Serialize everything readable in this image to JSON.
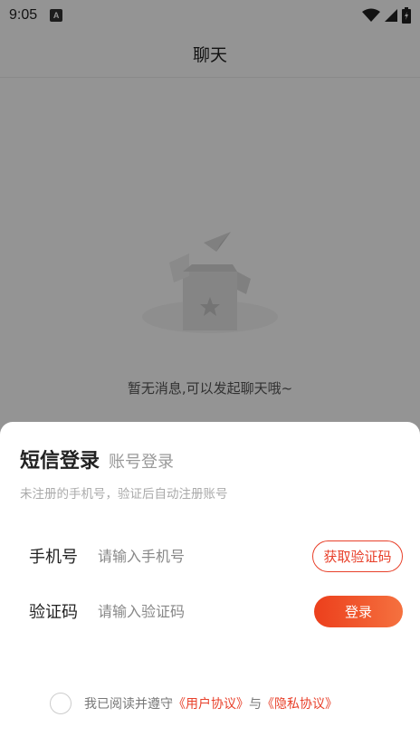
{
  "status_bar": {
    "time": "9:05",
    "app_icon_letter": "A"
  },
  "page": {
    "title": "聊天",
    "empty_message": "暂无消息,可以发起聊天哦~"
  },
  "login_sheet": {
    "tab_sms": "短信登录",
    "tab_account": "账号登录",
    "hint": "未注册的手机号，验证后自动注册账号",
    "phone_label": "手机号",
    "phone_placeholder": "请输入手机号",
    "phone_value": "",
    "get_code_button": "获取验证码",
    "code_label": "验证码",
    "code_placeholder": "请输入验证码",
    "code_value": "",
    "login_button": "登录",
    "agreement_prefix": "我已阅读并遵守",
    "user_agreement": "《用户协议》",
    "agreement_and": "与",
    "privacy_agreement": "《隐私协议》",
    "agreement_checked": false
  },
  "colors": {
    "accent": "#e8402a",
    "login_gradient_start": "#ec3f1c",
    "login_gradient_end": "#f5713f",
    "overlay": "rgba(0,0,0,0.42)"
  },
  "icons": [
    "wifi-icon",
    "signal-icon",
    "battery-icon",
    "empty-box-icon"
  ]
}
